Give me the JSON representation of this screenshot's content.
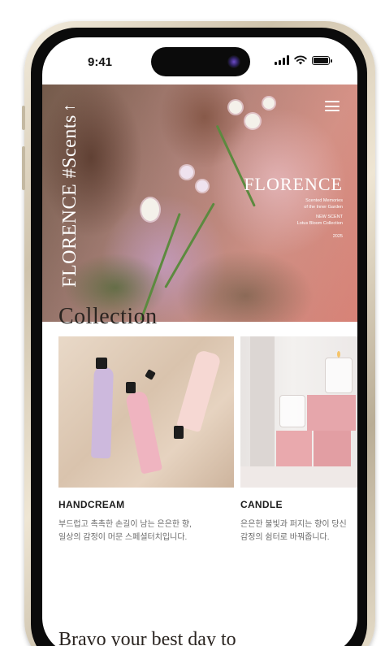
{
  "status_bar": {
    "time": "9:41"
  },
  "hero": {
    "vertical_title": "FLORENCE #Scents",
    "brand_logo": "FLORENCE",
    "brand_lines": [
      "Scented Memories",
      "of the Inner Garden",
      "NEW SCENT",
      "Lotus Bloom Collection",
      "2025"
    ]
  },
  "collection": {
    "title": "Collection",
    "cards": [
      {
        "title": "HANDCREAM",
        "desc_line1": "부드럽고 촉촉한 손길이 남는 은은한 향,",
        "desc_line2": "일상의 감정이 머문 스페셜터치입니다."
      },
      {
        "title": "CANDLE",
        "desc_line1": "은은한 불빛과 퍼지는 향이 당신",
        "desc_line2": "감정의 쉼터로 바꿔줍니다."
      }
    ]
  },
  "next_section": {
    "title": "Bravo your best day to"
  },
  "colors": {
    "accent": "#e6a6ab",
    "text": "#2a2420",
    "muted": "#6b6b6b"
  }
}
